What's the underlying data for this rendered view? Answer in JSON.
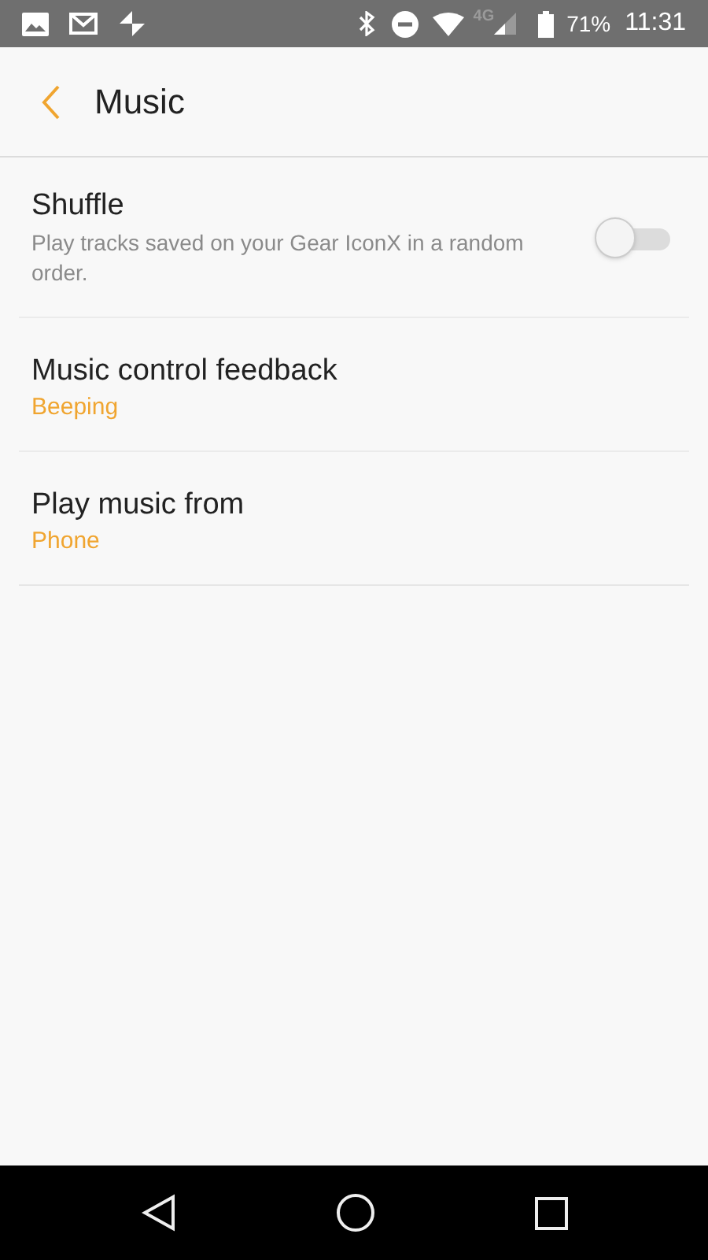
{
  "status_bar": {
    "network": "4G",
    "battery": "71%",
    "time": "11:31"
  },
  "header": {
    "title": "Music"
  },
  "settings": [
    {
      "kind": "toggle",
      "title": "Shuffle",
      "description": "Play tracks saved on your Gear IconX in a random order.",
      "on": false
    },
    {
      "kind": "value",
      "title": "Music control feedback",
      "value": "Beeping"
    },
    {
      "kind": "value",
      "title": "Play music from",
      "value": "Phone"
    }
  ]
}
